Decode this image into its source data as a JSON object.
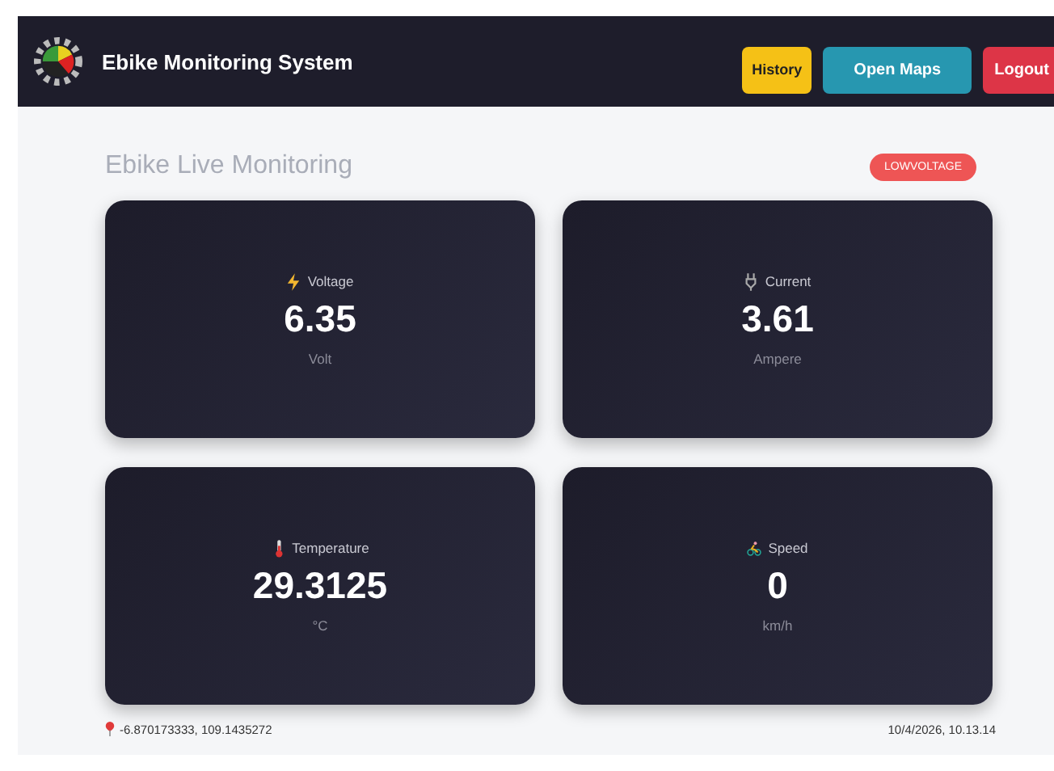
{
  "header": {
    "title": "Ebike Monitoring System",
    "buttons": [
      {
        "label": "History",
        "kind": "history"
      },
      {
        "label": "Open Maps",
        "kind": "maps"
      },
      {
        "label": "Logout",
        "kind": "logout"
      }
    ]
  },
  "page": {
    "heading": "Ebike Live Monitoring",
    "status_badge": "LOWVOLTAGE"
  },
  "cards": [
    {
      "kind": "voltage",
      "label": "Voltage",
      "value": "6.35",
      "unit": "Volt"
    },
    {
      "kind": "current",
      "label": "Current",
      "value": "3.61",
      "unit": "Ampere"
    },
    {
      "kind": "temperature",
      "label": "Temperature",
      "value": "29.3125",
      "unit": "°C"
    },
    {
      "kind": "speed",
      "label": "Speed",
      "value": "0",
      "unit": "km/h"
    }
  ],
  "footer": {
    "location": "-6.870173333, 109.1435272",
    "timestamp": "10/4/2026, 10.13.14"
  }
}
